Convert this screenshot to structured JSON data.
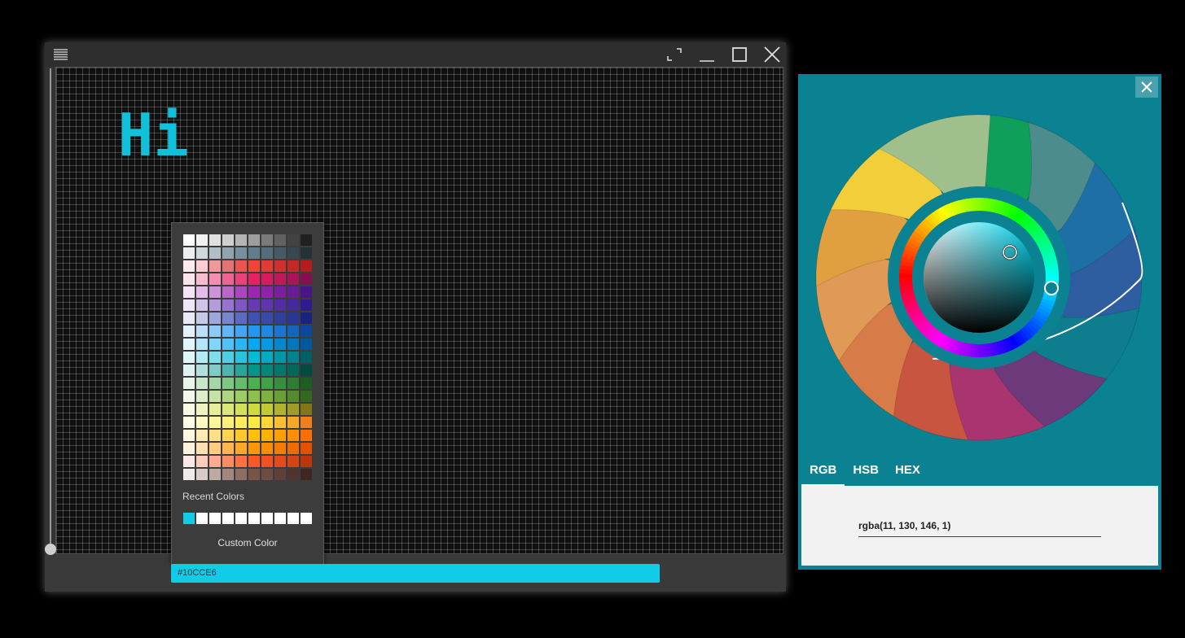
{
  "main_window": {
    "canvas_text": "Hi",
    "hex_input_value": "#10CCE6",
    "hex_bar_color": "#10CCE6",
    "text_color": "#10C1D9",
    "titlebar_icons": [
      "menu-icon",
      "fullscreen-icon",
      "minimize-icon",
      "maximize-icon",
      "close-icon"
    ]
  },
  "palette": {
    "rows": [
      [
        "#FFFFFF",
        "#F2F2F2",
        "#E0E0E0",
        "#CFCFCF",
        "#B5B5B5",
        "#9E9E9E",
        "#7A7A7A",
        "#616161",
        "#424242",
        "#212121"
      ],
      [
        "#ECEFF1",
        "#CFD8DC",
        "#B0BEC5",
        "#90A4AE",
        "#78909C",
        "#607D8B",
        "#546E7A",
        "#455A64",
        "#37474F",
        "#263238"
      ],
      [
        "#FFEBEE",
        "#FFCDD2",
        "#EF9A9A",
        "#E57373",
        "#EF5350",
        "#F44336",
        "#E53935",
        "#D32F2F",
        "#C62828",
        "#B71C1C"
      ],
      [
        "#FCE4EC",
        "#F8BBD0",
        "#F48FB1",
        "#F06292",
        "#EC407A",
        "#E91E63",
        "#D81B60",
        "#C2185B",
        "#AD1457",
        "#880E4F"
      ],
      [
        "#F3E5F5",
        "#E1BEE7",
        "#CE93D8",
        "#BA68C8",
        "#AB47BC",
        "#9C27B0",
        "#8E24AA",
        "#7B1FA2",
        "#6A1B9A",
        "#4A148C"
      ],
      [
        "#EDE7F6",
        "#D1C4E9",
        "#B39DDB",
        "#9575CD",
        "#7E57C2",
        "#673AB7",
        "#5E35B1",
        "#512DA8",
        "#4527A0",
        "#311B92"
      ],
      [
        "#E8EAF6",
        "#C5CAE9",
        "#9FA8DA",
        "#7986CB",
        "#5C6BC0",
        "#3F51B5",
        "#3949AB",
        "#303F9F",
        "#283593",
        "#1A237E"
      ],
      [
        "#E3F2FD",
        "#BBDEFB",
        "#90CAF9",
        "#64B5F6",
        "#42A5F5",
        "#2196F3",
        "#1E88E5",
        "#1976D2",
        "#1565C0",
        "#0D47A1"
      ],
      [
        "#E1F5FE",
        "#B3E5FC",
        "#81D4FA",
        "#4FC3F7",
        "#29B6F6",
        "#03A9F4",
        "#039BE5",
        "#0288D1",
        "#0277BD",
        "#01579B"
      ],
      [
        "#E0F7FA",
        "#B2EBF2",
        "#80DEEA",
        "#4DD0E1",
        "#26C6DA",
        "#00BCD4",
        "#00ACC1",
        "#0097A7",
        "#00838F",
        "#006064"
      ],
      [
        "#E0F2F1",
        "#B2DFDB",
        "#80CBC4",
        "#4DB6AC",
        "#26A69A",
        "#009688",
        "#00897B",
        "#00796B",
        "#00695C",
        "#004D40"
      ],
      [
        "#E8F5E9",
        "#C8E6C9",
        "#A5D6A7",
        "#81C784",
        "#66BB6A",
        "#4CAF50",
        "#43A047",
        "#388E3C",
        "#2E7D32",
        "#1B5E20"
      ],
      [
        "#F1F8E9",
        "#DCEDC8",
        "#C5E1A5",
        "#AED581",
        "#9CCC65",
        "#8BC34A",
        "#7CB342",
        "#689F38",
        "#558B2F",
        "#33691E"
      ],
      [
        "#F9FBE7",
        "#F0F4C3",
        "#E6EE9C",
        "#DCE775",
        "#D4E157",
        "#CDDC39",
        "#C0CA33",
        "#AFB42B",
        "#9E9D24",
        "#827717"
      ],
      [
        "#FFFDE7",
        "#FFF9C4",
        "#FFF59D",
        "#FFF176",
        "#FFEE58",
        "#FFEB3B",
        "#FDD835",
        "#FBC02D",
        "#F9A825",
        "#F57F17"
      ],
      [
        "#FFF8E1",
        "#FFECB3",
        "#FFE082",
        "#FFD54F",
        "#FFCA28",
        "#FFC107",
        "#FFB300",
        "#FFA000",
        "#FF8F00",
        "#FF6F00"
      ],
      [
        "#FFF3E0",
        "#FFE0B2",
        "#FFCC80",
        "#FFB74D",
        "#FFA726",
        "#FF9800",
        "#FB8C00",
        "#F57C00",
        "#EF6C00",
        "#E65100"
      ],
      [
        "#FBE9E7",
        "#FFCCBC",
        "#FFAB91",
        "#FF8A65",
        "#FF7043",
        "#FF5722",
        "#F4511E",
        "#E64A19",
        "#D84315",
        "#BF360C"
      ],
      [
        "#EFEBE9",
        "#D7CCC8",
        "#BCAAA4",
        "#A1887F",
        "#8D6E63",
        "#795548",
        "#6D4C41",
        "#5D4037",
        "#4E342E",
        "#3E2723"
      ]
    ],
    "recent_label": "Recent Colors",
    "recent": [
      "#10CCE6",
      "#FFFFFF",
      "#FFFFFF",
      "#FFFFFF",
      "#FFFFFF",
      "#FFFFFF",
      "#FFFFFF",
      "#FFFFFF",
      "#FFFFFF",
      "#FFFFFF"
    ],
    "custom_label": "Custom Color"
  },
  "picker": {
    "background": "#0B8292",
    "petal_colors": [
      "#0F9F5A",
      "#4D8C8C",
      "#1E6FA6",
      "#2F5EA0",
      "#0E7E8E",
      "#6C3A7A",
      "#A83570",
      "#C8553F",
      "#D77B48",
      "#E09A55",
      "#E0A040",
      "#F2CF3A",
      "#9FC08C"
    ],
    "tabs": [
      "RGB",
      "HSB",
      "HEX"
    ],
    "active_tab": "RGB",
    "value": "rgba(11, 130, 146, 1)"
  }
}
